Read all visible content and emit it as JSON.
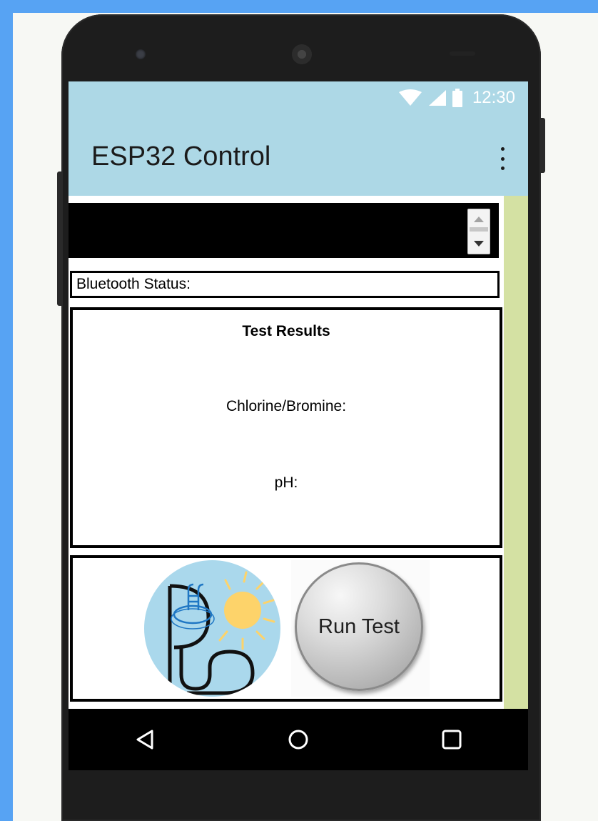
{
  "status_bar": {
    "time": "12:30",
    "icons": [
      "wifi-icon",
      "signal-icon",
      "battery-icon"
    ]
  },
  "app_bar": {
    "title": "ESP32 Control",
    "menu_icon": "overflow-menu-icon",
    "background": "#add8e6"
  },
  "list_picker": {
    "value": ""
  },
  "bluetooth": {
    "label": "Bluetooth Status:"
  },
  "results": {
    "title": "Test Results",
    "chlorine_label": "Chlorine/Bromine:",
    "ph_label": "pH:"
  },
  "actions": {
    "logo_icon": "pool-sun-logo",
    "run_label": "Run Test"
  },
  "nav": {
    "back": "back-icon",
    "home": "home-icon",
    "recents": "recents-icon"
  },
  "colors": {
    "page_bg": "#57a3f3",
    "side_strip": "#d4e1a3",
    "sun": "#fdd36a",
    "logo_bg": "#aad8ec"
  }
}
